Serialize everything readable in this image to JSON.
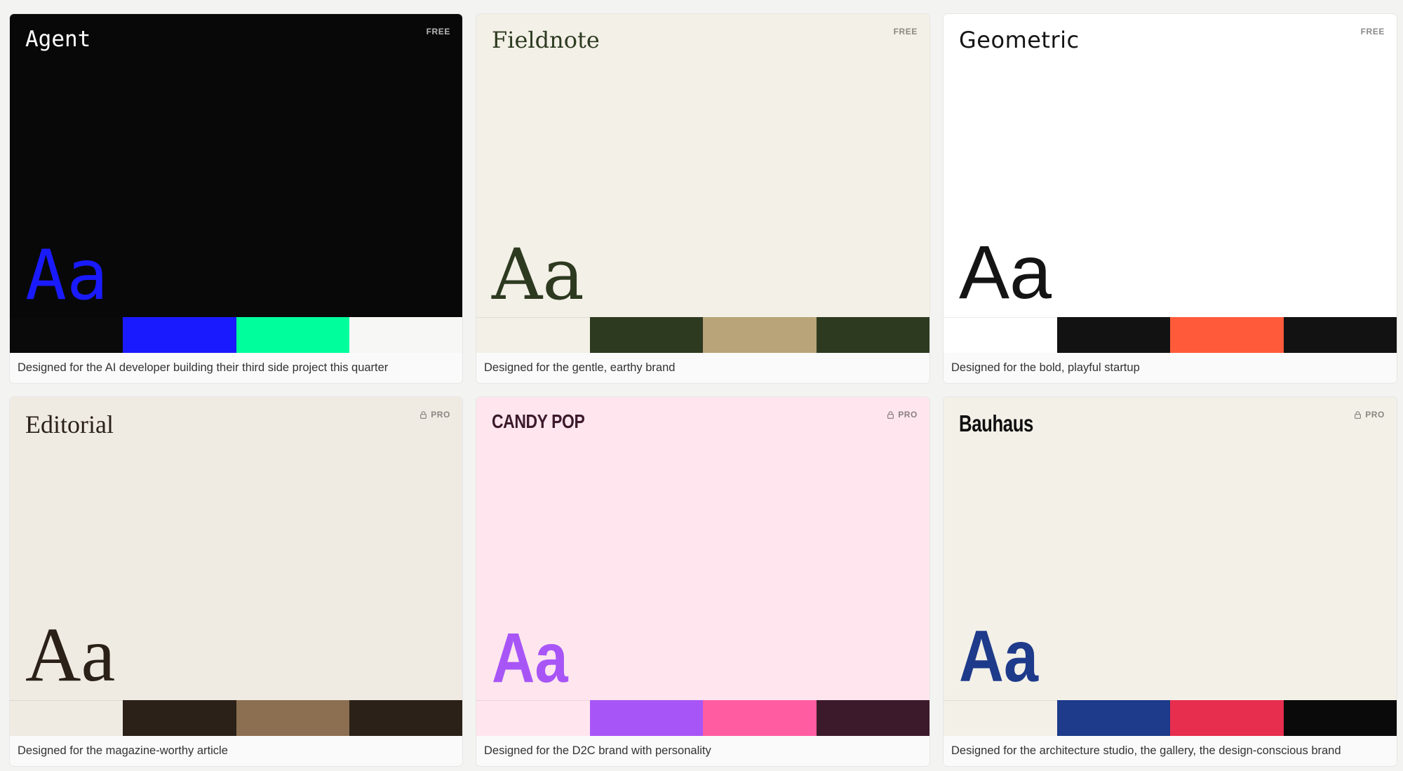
{
  "themes": [
    {
      "id": "agent",
      "name": "Agent",
      "tier": "FREE",
      "locked": false,
      "sample": "Aa",
      "description": "Designed for the AI developer building their third side project this quarter",
      "colors": {
        "background": "#080808",
        "title": "#ffffff",
        "sample": "#1a1aff",
        "tier": "#b8b8b8"
      },
      "swatches": [
        "#0a0a0a",
        "#1a1aff",
        "#00ff9c",
        "#f7f7f5"
      ]
    },
    {
      "id": "fieldnote",
      "name": "Fieldnote",
      "tier": "FREE",
      "locked": false,
      "sample": "Aa",
      "description": "Designed for the gentle, earthy brand",
      "colors": {
        "background": "#f3f0e7",
        "title": "#2d3a20",
        "sample": "#2d3a20",
        "tier": "#8a8a80"
      },
      "swatches": [
        "#f3f0e7",
        "#2d3a20",
        "#b8a478",
        "#2d3a20"
      ]
    },
    {
      "id": "geometric",
      "name": "Geometric",
      "tier": "FREE",
      "locked": false,
      "sample": "Aa",
      "description": "Designed for the bold, playful startup",
      "colors": {
        "background": "#ffffff",
        "title": "#141414",
        "sample": "#141414",
        "tier": "#8a8a8a"
      },
      "swatches": [
        "#ffffff",
        "#121212",
        "#ff5b3a",
        "#121212"
      ]
    },
    {
      "id": "editorial",
      "name": "Editorial",
      "tier": "PRO",
      "locked": true,
      "sample": "Aa",
      "description": "Designed for the magazine-worthy article",
      "colors": {
        "background": "#efebe3",
        "title": "#2b2118",
        "sample": "#2b2118",
        "tier": "#8a8580"
      },
      "swatches": [
        "#efebe3",
        "#2b2118",
        "#8b6f50",
        "#2b2118"
      ]
    },
    {
      "id": "candy",
      "name": "CANDY POP",
      "tier": "PRO",
      "locked": true,
      "sample": "Aa",
      "description": "Designed for the D2C brand with personality",
      "colors": {
        "background": "#ffe6ee",
        "title": "#3c1a2b",
        "sample": "#a855f7",
        "tier": "#8a7f84"
      },
      "swatches": [
        "#ffe6ee",
        "#a855f7",
        "#ff5ca1",
        "#3c1a2b"
      ]
    },
    {
      "id": "bauhaus",
      "name": "Bauhaus",
      "tier": "PRO",
      "locked": true,
      "sample": "Aa",
      "description": "Designed for the architecture studio, the gallery, the design-conscious brand",
      "colors": {
        "background": "#f3f0e8",
        "title": "#0f0f0f",
        "sample": "#1e3a8a",
        "tier": "#8a8680"
      },
      "swatches": [
        "#f3f0e8",
        "#1e3a8a",
        "#e72e4f",
        "#0a0a0a"
      ]
    }
  ],
  "icons": {
    "lock": "lock-icon"
  }
}
